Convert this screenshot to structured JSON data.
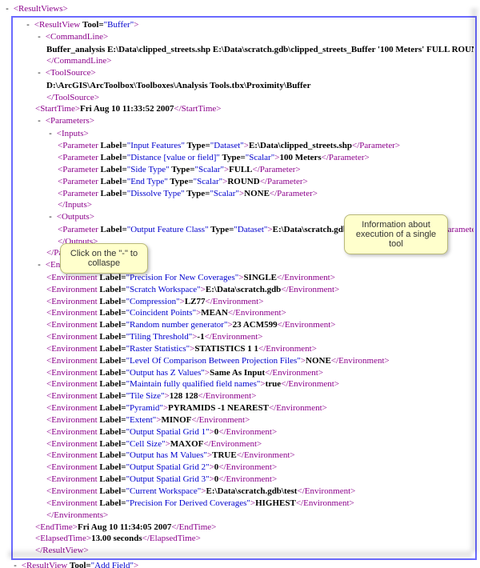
{
  "root": {
    "tag": "ResultViews"
  },
  "resultView": {
    "tag": "ResultView",
    "toolAttr": "Tool",
    "toolVal": "Buffer",
    "commandLine": {
      "tag": "CommandLine",
      "text": "Buffer_analysis E:\\Data\\clipped_streets.shp E:\\Data\\scratch.gdb\\clipped_streets_Buffer '100 Meters' FULL ROUND NO"
    },
    "toolSource": {
      "tag": "ToolSource",
      "text": "D:\\ArcGIS\\ArcToolbox\\Toolboxes\\Analysis Tools.tbx\\Proximity\\Buffer"
    },
    "startTime": {
      "tag": "StartTime",
      "text": "Fri Aug 10 11:33:52 2007"
    },
    "parameters": {
      "tag": "Parameters",
      "inputsTag": "Inputs",
      "outputsTag": "Outputs",
      "paramTag": "Parameter",
      "labelAttr": "Label",
      "typeAttr": "Type",
      "inputs": [
        {
          "label": "Input Features",
          "type": "Dataset",
          "value": "E:\\Data\\clipped_streets.shp"
        },
        {
          "label": "Distance [value or field]",
          "type": "Scalar",
          "value": "100 Meters"
        },
        {
          "label": "Side Type",
          "type": "Scalar",
          "value": "FULL"
        },
        {
          "label": "End Type",
          "type": "Scalar",
          "value": "ROUND"
        },
        {
          "label": "Dissolve Type",
          "type": "Scalar",
          "value": "NONE"
        }
      ],
      "outputs": [
        {
          "label": "Output Feature Class",
          "type": "Dataset",
          "value": "E:\\Data\\scratch.gdb\\clipped_streets_Buffer"
        }
      ]
    },
    "environments": {
      "tag": "Environments",
      "envTag": "Environment",
      "labelAttr": "Label",
      "items": [
        {
          "label": "Precision For New Coverages",
          "value": "SINGLE",
          "obscured": true
        },
        {
          "label": "Scratch Workspace",
          "value": "E:\\Data\\scratch.gdb",
          "obscured": true
        },
        {
          "label": "Compression",
          "value": "LZ77",
          "obscured": true
        },
        {
          "label": "Coincident Points",
          "value": "MEAN"
        },
        {
          "label": "Random number generator",
          "value": "23 ACM599"
        },
        {
          "label": "Tiling Threshold",
          "value": "-1"
        },
        {
          "label": "Raster Statistics",
          "value": "STATISTICS 1 1"
        },
        {
          "label": "Level Of Comparison Between Projection Files",
          "value": "NONE"
        },
        {
          "label": "Output has Z Values",
          "value": "Same As Input"
        },
        {
          "label": "Maintain fully qualified field names",
          "value": "true"
        },
        {
          "label": "Tile Size",
          "value": "128 128"
        },
        {
          "label": "Pyramid",
          "value": "PYRAMIDS -1 NEAREST"
        },
        {
          "label": "Extent",
          "value": "MINOF"
        },
        {
          "label": "Output Spatial Grid 1",
          "value": "0"
        },
        {
          "label": "Cell Size",
          "value": "MAXOF"
        },
        {
          "label": "Output has M Values",
          "value": "TRUE"
        },
        {
          "label": "Output Spatial Grid 2",
          "value": "0"
        },
        {
          "label": "Output Spatial Grid 3",
          "value": "0"
        },
        {
          "label": "Current Workspace",
          "value": "E:\\Data\\scratch.gdb\\test"
        },
        {
          "label": "Precision For Derived Coverages",
          "value": "HIGHEST"
        }
      ]
    },
    "endTime": {
      "tag": "EndTime",
      "text": "Fri Aug 10 11:34:05 2007"
    },
    "elapsed": {
      "tag": "ElapsedTime",
      "text": "13.00 seconds"
    }
  },
  "nextResultView": {
    "tag": "ResultView",
    "toolAttr": "Tool",
    "toolVal": "Add Field"
  },
  "callouts": {
    "collapse": "Click on the \"-\" to collaspe",
    "info": "Information about execution of a single tool"
  }
}
